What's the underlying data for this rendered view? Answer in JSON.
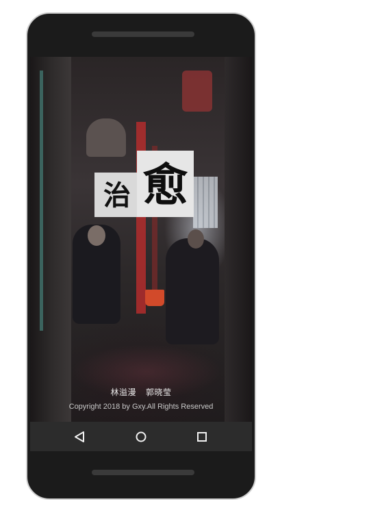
{
  "app": {
    "logo_chars": [
      "治",
      "愈"
    ],
    "authors": [
      "林溢漫",
      "郭晓莹"
    ],
    "copyright": "Copyright 2018 by Gxy.All Rights Reserved"
  },
  "navbar": {
    "buttons": [
      {
        "icon": "back-triangle-icon"
      },
      {
        "icon": "home-circle-icon"
      },
      {
        "icon": "recents-square-icon"
      }
    ]
  },
  "colors": {
    "phone_body": "#1b1b1b",
    "navbar": "#2c2c2c",
    "text": "#e9e9e9"
  }
}
